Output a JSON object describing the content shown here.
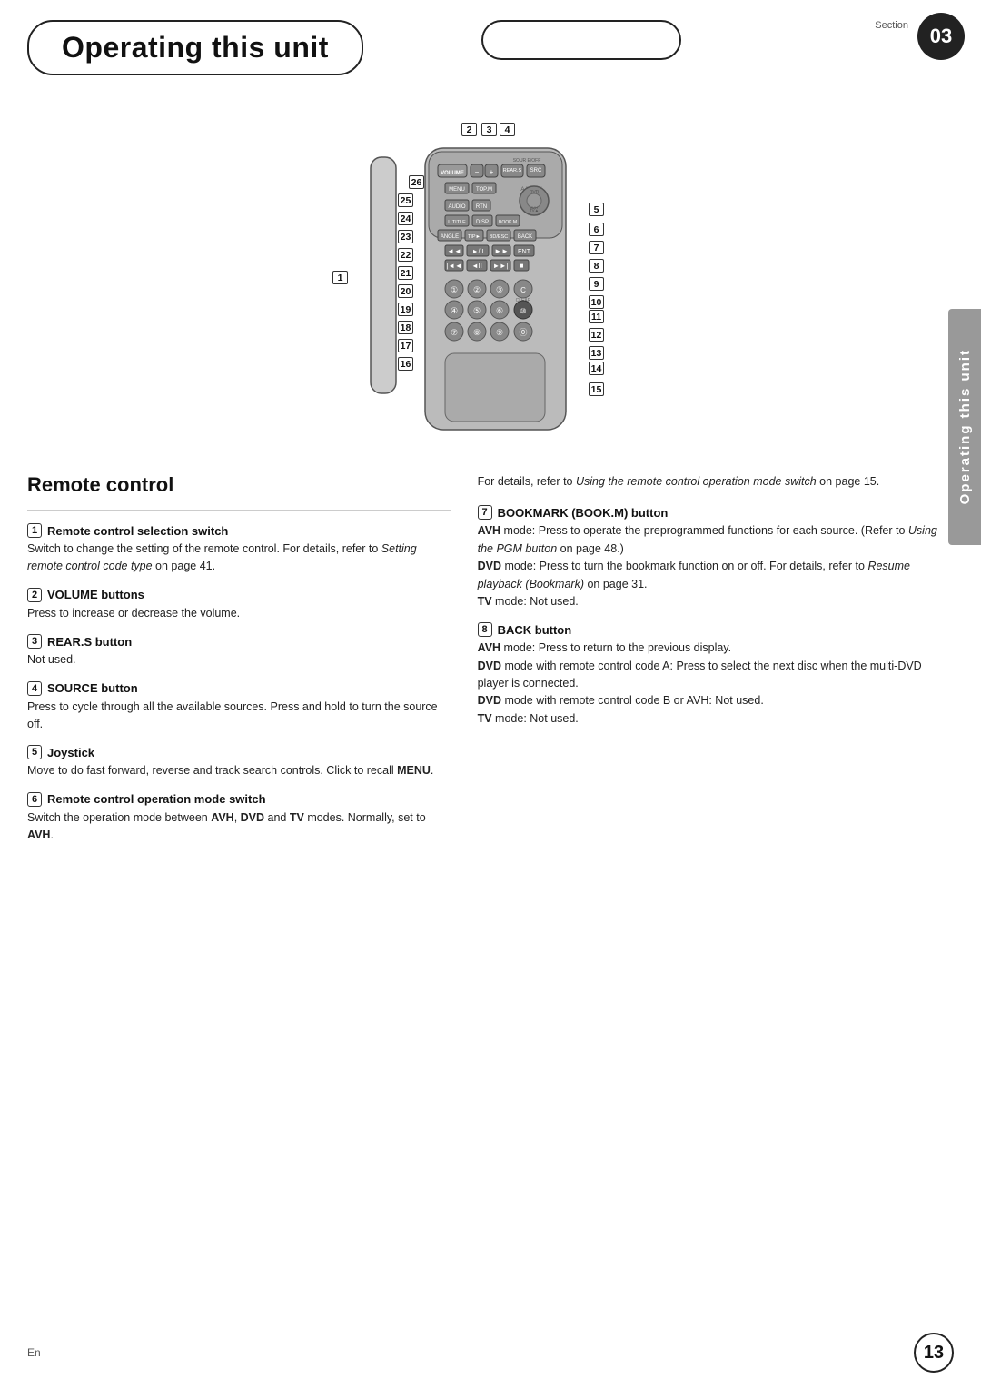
{
  "header": {
    "title": "Operating this unit",
    "section_label": "Section",
    "section_number": "03"
  },
  "side_tab": {
    "text": "Operating this unit"
  },
  "diagram": {
    "numbers": [
      {
        "id": "1",
        "label": "1"
      },
      {
        "id": "2",
        "label": "2"
      },
      {
        "id": "3",
        "label": "3"
      },
      {
        "id": "4",
        "label": "4"
      },
      {
        "id": "5",
        "label": "5"
      },
      {
        "id": "6",
        "label": "6"
      },
      {
        "id": "7",
        "label": "7"
      },
      {
        "id": "8",
        "label": "8"
      },
      {
        "id": "9",
        "label": "9"
      },
      {
        "id": "10",
        "label": "10"
      },
      {
        "id": "11",
        "label": "11"
      },
      {
        "id": "12",
        "label": "12"
      },
      {
        "id": "13",
        "label": "13"
      },
      {
        "id": "14",
        "label": "14"
      },
      {
        "id": "15",
        "label": "15"
      },
      {
        "id": "16",
        "label": "16"
      },
      {
        "id": "17",
        "label": "17"
      },
      {
        "id": "18",
        "label": "18"
      },
      {
        "id": "19",
        "label": "19"
      },
      {
        "id": "20",
        "label": "20"
      },
      {
        "id": "21",
        "label": "21"
      },
      {
        "id": "22",
        "label": "22"
      },
      {
        "id": "23",
        "label": "23"
      },
      {
        "id": "24",
        "label": "24"
      },
      {
        "id": "25",
        "label": "25"
      },
      {
        "id": "26",
        "label": "26"
      }
    ]
  },
  "remote_control_section": {
    "title": "Remote control",
    "items": [
      {
        "number": "1",
        "heading": "Remote control selection switch",
        "body": "Switch to change the setting of the remote control. For details, refer to ",
        "italic": "Setting remote control code type",
        "body2": " on page 41."
      },
      {
        "number": "2",
        "heading": "VOLUME buttons",
        "body": "Press to increase or decrease the volume."
      },
      {
        "number": "3",
        "heading": "REAR.S button",
        "body": "Not used."
      },
      {
        "number": "4",
        "heading": "SOURCE button",
        "body": "Press to cycle through all the available sources. Press and hold to turn the source off."
      },
      {
        "number": "5",
        "heading": "Joystick",
        "body": "Move to do fast forward, reverse and track search controls. Click to recall ",
        "bold": "MENU",
        "body2": "."
      },
      {
        "number": "6",
        "heading": "Remote control operation mode switch",
        "body": "Switch the operation mode between ",
        "bold1": "AVH",
        "body2": ", ",
        "bold2": "DVD",
        "body3": " and ",
        "bold3": "TV",
        "body4": " modes. Normally, set to ",
        "bold4": "AVH",
        "body5": "."
      }
    ],
    "intro_right": "For details, refer to ",
    "intro_right_italic": "Using the remote control operation mode switch",
    "intro_right2": " on page 15.",
    "items_right": [
      {
        "number": "7",
        "heading": "BOOKMARK (BOOK.M) button",
        "avh_label": "AVH",
        "avh_body": " mode: Press to operate the preprogrammed functions for each source. (Refer to ",
        "avh_italic": "Using the PGM button",
        "avh_body2": " on page 48.)",
        "dvd_label": "DVD",
        "dvd_body": " mode: Press to turn the bookmark function on or off. For details, refer to ",
        "dvd_italic": "Resume playback (Bookmark)",
        "dvd_body2": " on page 31.",
        "tv_label": "TV",
        "tv_body": " mode: Not used."
      },
      {
        "number": "8",
        "heading": "BACK button",
        "avh_label": "AVH",
        "avh_body": " mode: Press to return to the previous display.",
        "dvd_label": "DVD",
        "dvd_body": " mode with remote control code A: Press to select the next disc when the multi-DVD player is connected.",
        "dvd_label2": "DVD",
        "dvd_body2": " mode with remote control code B or AVH: Not used.",
        "tv_label": "TV",
        "tv_body": " mode: Not used."
      }
    ]
  },
  "footer": {
    "en_label": "En",
    "page_number": "13"
  }
}
